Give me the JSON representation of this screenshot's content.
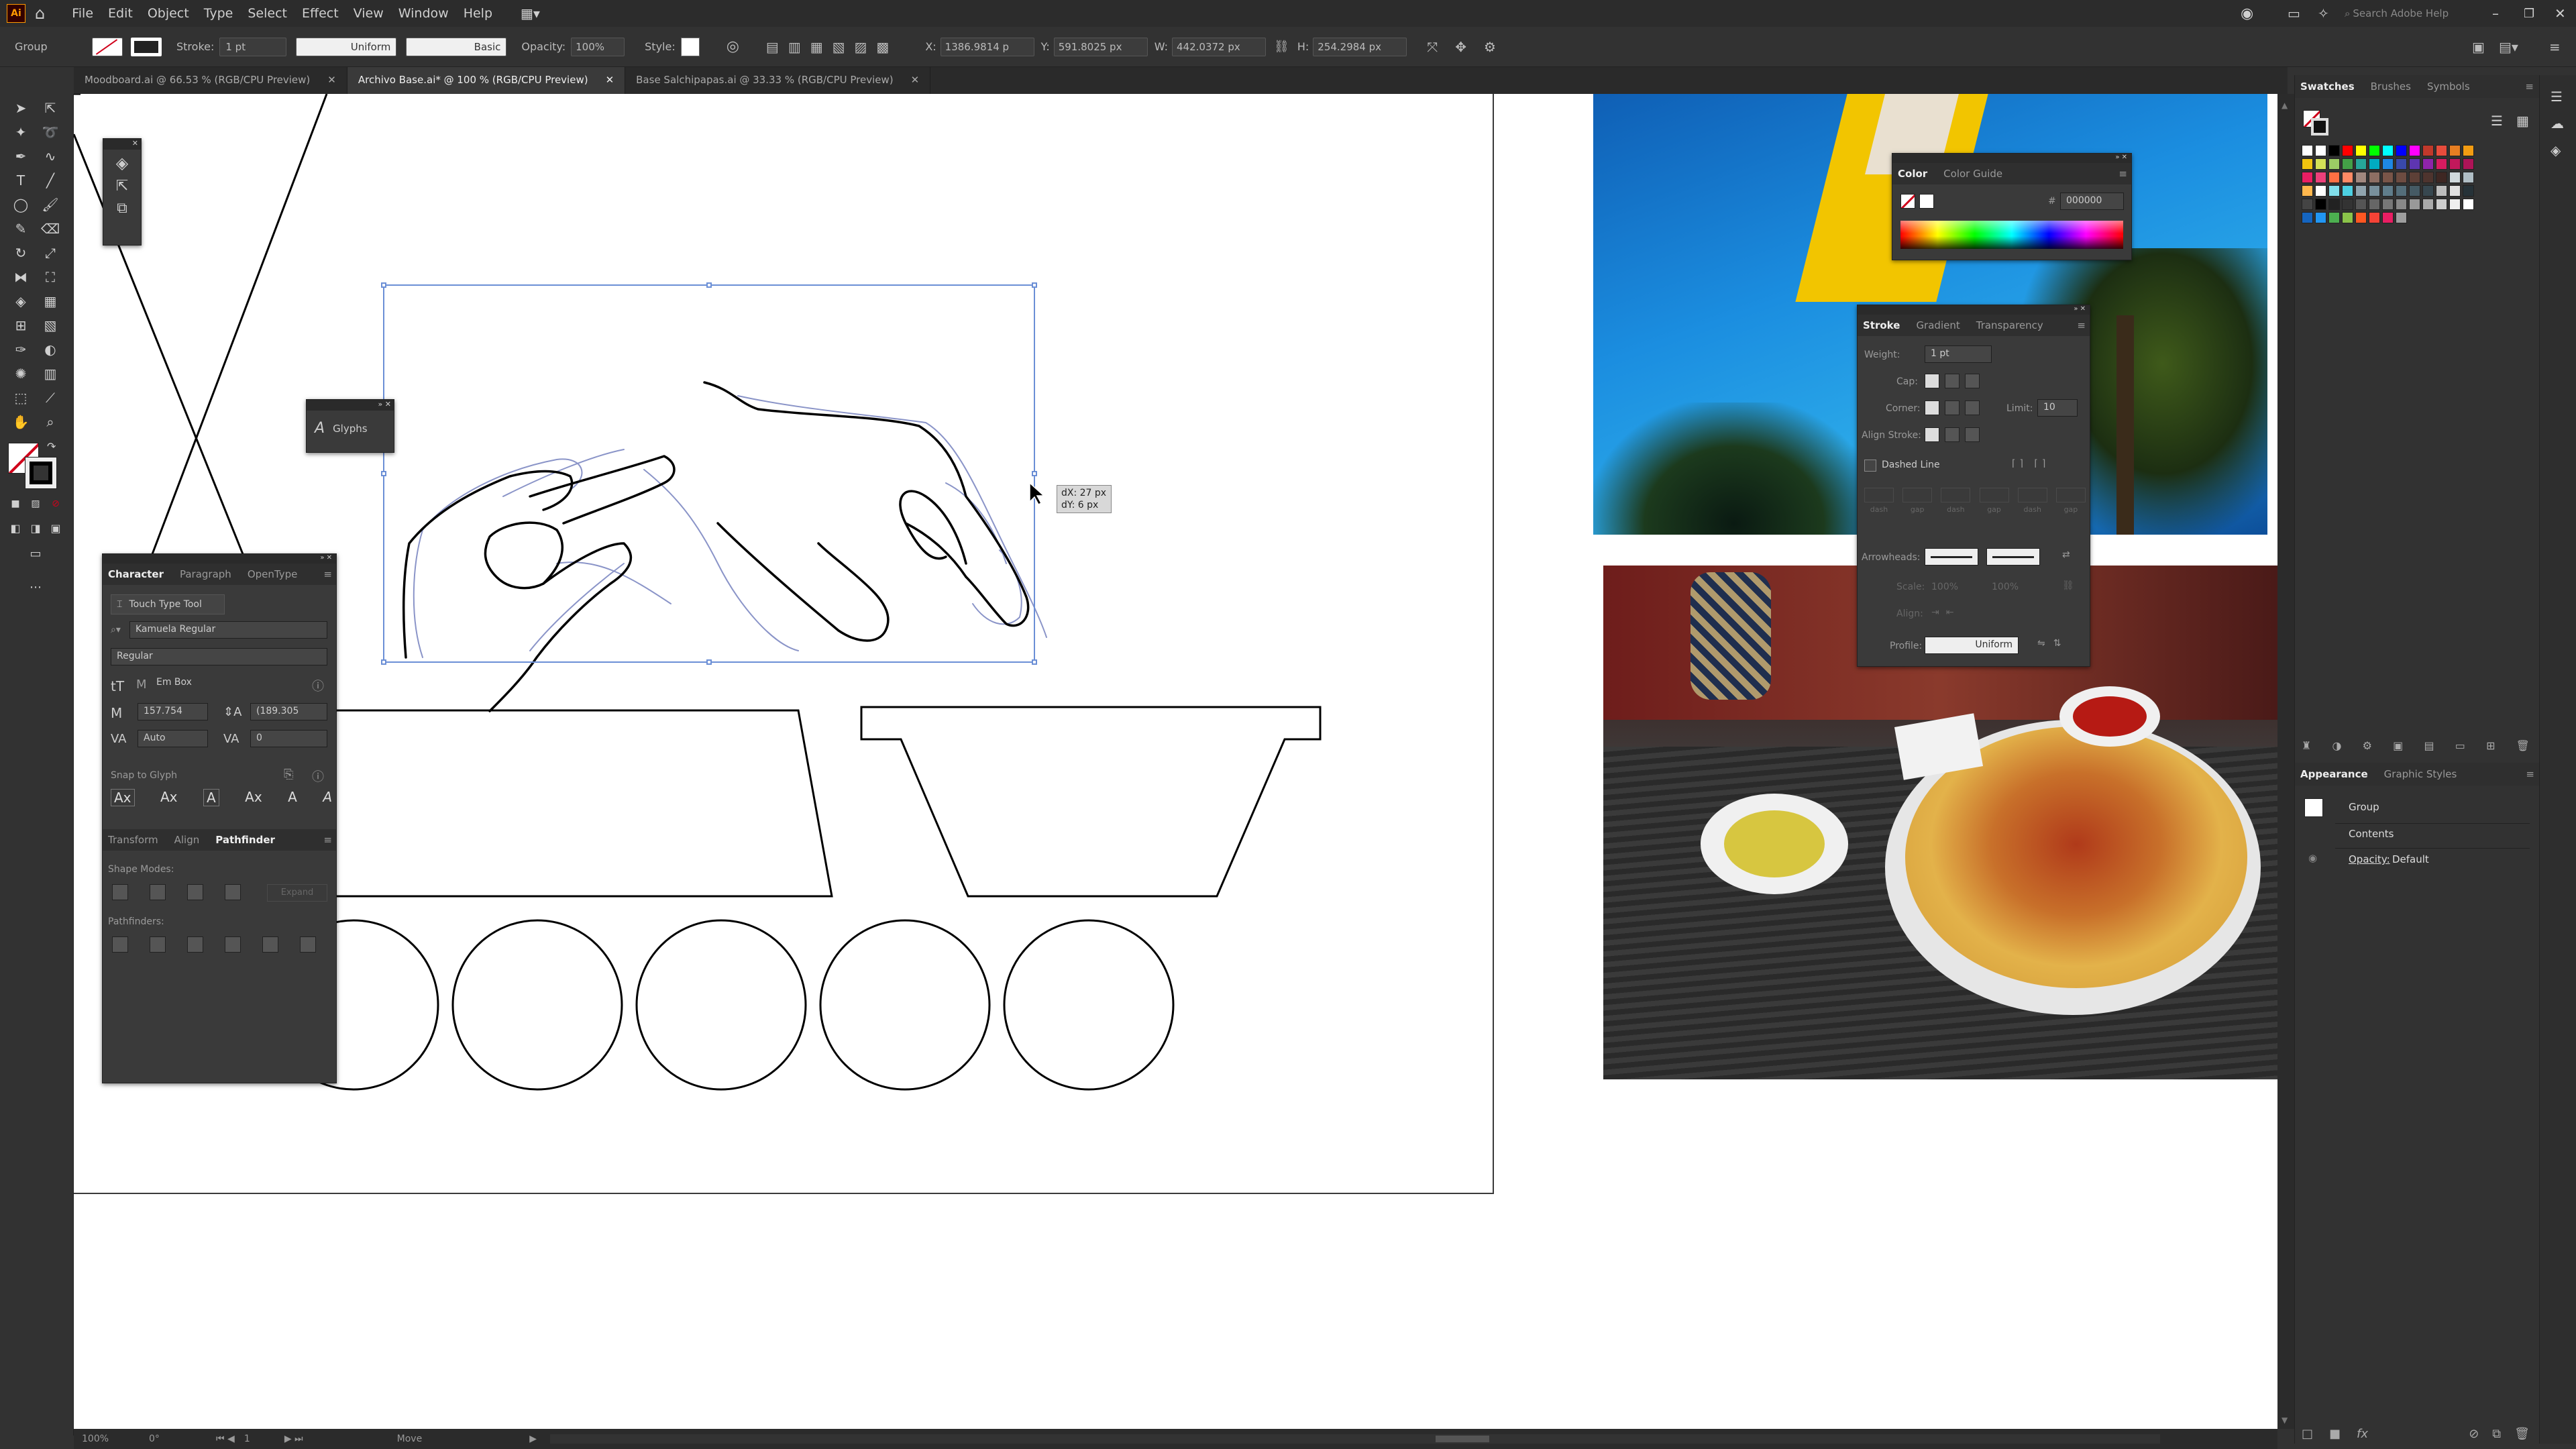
{
  "app": {
    "logo": "Ai"
  },
  "menu": [
    "File",
    "Edit",
    "Object",
    "Type",
    "Select",
    "Effect",
    "View",
    "Window",
    "Help"
  ],
  "control_bar": {
    "selection": "Group",
    "stroke_label": "Stroke:",
    "stroke_weight": "1 pt",
    "profile": "Uniform",
    "brush": "Basic",
    "opacity_label": "Opacity:",
    "opacity": "100%",
    "style_label": "Style:",
    "x_label": "X:",
    "x": "1386.9814 p",
    "y_label": "Y:",
    "y": "591.8025 px",
    "w_label": "W:",
    "w": "442.0372 px",
    "h_label": "H:",
    "h": "254.2984 px",
    "search_placeholder": "Search Adobe Help"
  },
  "tabs": [
    {
      "label": "Moodboard.ai @ 66.53 % (RGB/CPU Preview)"
    },
    {
      "label": "Archivo Base.ai* @ 100 % (RGB/CPU Preview)"
    },
    {
      "label": "Base Salchipapas.ai @ 33.33 % (RGB/CPU Preview)"
    }
  ],
  "glyphs_panel": {
    "title": "Glyphs"
  },
  "character_panel": {
    "tabs": [
      "Character",
      "Paragraph",
      "OpenType"
    ],
    "touch_type": "Touch Type Tool",
    "font": "Kamuela Regular",
    "style": "Regular",
    "em_box": "Em Box",
    "font_size": "157.754",
    "leading": "(189.305",
    "tracking_kerning": "Auto",
    "tracking": "0",
    "snap_label": "Snap to Glyph"
  },
  "pathfinder_panel": {
    "tabs": [
      "Transform",
      "Align",
      "Pathfinder"
    ],
    "shape_modes": "Shape Modes:",
    "expand": "Expand",
    "pathfinders": "Pathfinders:"
  },
  "color_panel": {
    "tabs": [
      "Color",
      "Color Guide"
    ],
    "hex_label": "#",
    "hex": "000000"
  },
  "stroke_panel": {
    "tabs": [
      "Stroke",
      "Gradient",
      "Transparency"
    ],
    "weight_label": "Weight:",
    "weight": "1 pt",
    "cap_label": "Cap:",
    "corner_label": "Corner:",
    "limit_label": "Limit:",
    "limit": "10",
    "align_label": "Align Stroke:",
    "dashed_label": "Dashed Line",
    "dash_labels": [
      "dash",
      "gap",
      "dash",
      "gap",
      "dash",
      "gap"
    ],
    "arrowheads_label": "Arrowheads:",
    "scale_label": "Scale:",
    "scale1": "100%",
    "scale2": "100%",
    "align2_label": "Align:",
    "profile_label": "Profile:",
    "profile": "Uniform"
  },
  "tooltip": {
    "dx": "dX: 27 px",
    "dy": "dY: 6 px"
  },
  "swatches_panel": {
    "tabs": [
      "Swatches",
      "Brushes",
      "Symbols"
    ]
  },
  "appearance_panel": {
    "tabs": [
      "Appearance",
      "Graphic Styles"
    ],
    "item": "Group",
    "contents": "Contents",
    "opacity_label": "Opacity:",
    "opacity": "Default"
  },
  "status": {
    "zoom": "100%",
    "rotate": "0°",
    "page": "1",
    "tool": "Move"
  },
  "colors": {
    "accent": "#d0021b",
    "ui_bg": "#323232",
    "panel_bg": "#3a3a3a"
  }
}
